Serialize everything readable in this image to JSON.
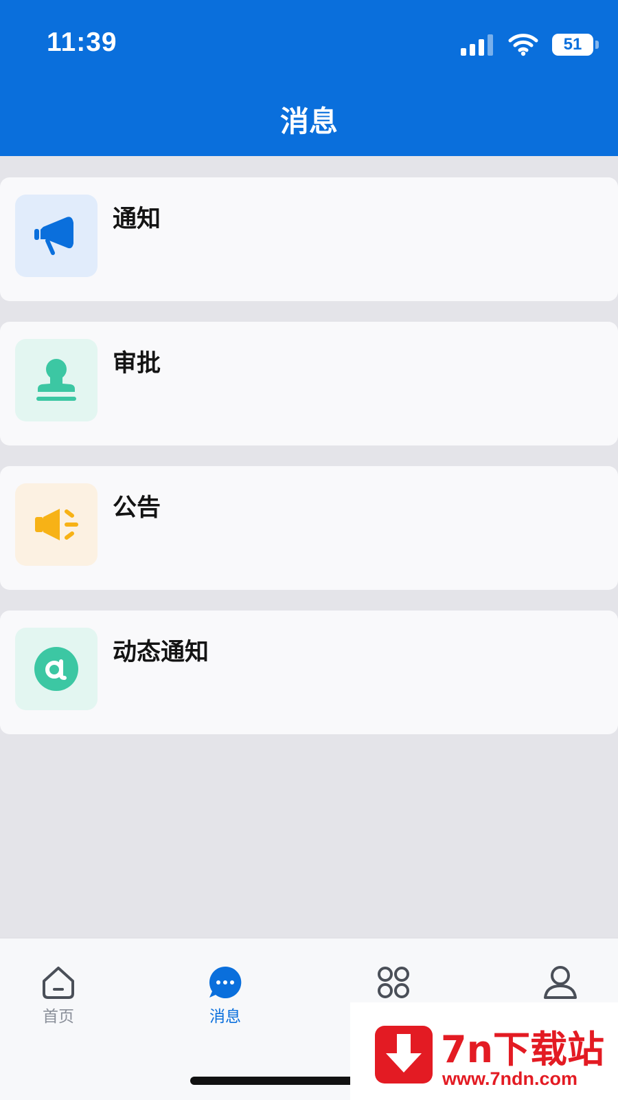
{
  "status_bar": {
    "time": "11:39",
    "battery": "51"
  },
  "header": {
    "title": "消息"
  },
  "messages": [
    {
      "label": "通知",
      "icon": "megaphone-icon",
      "icon_color": "#0a6fdc",
      "tile_color": "#e1ecfb"
    },
    {
      "label": "审批",
      "icon": "approval-stamp-icon",
      "icon_color": "#3cc7a3",
      "tile_color": "#e3f6f1"
    },
    {
      "label": "公告",
      "icon": "speaker-icon",
      "icon_color": "#f7b216",
      "tile_color": "#fcf1e2"
    },
    {
      "label": "动态通知",
      "icon": "at-sign-icon",
      "icon_color": "#3cc7a3",
      "tile_color": "#e3f6f1"
    }
  ],
  "tabbar": {
    "tabs": [
      {
        "label": "首页",
        "icon": "home-icon",
        "active": false
      },
      {
        "label": "消息",
        "icon": "chat-bubble-icon",
        "active": true
      },
      {
        "label": "",
        "icon": "apps-grid-icon",
        "active": false
      },
      {
        "label": "",
        "icon": "user-icon",
        "active": false
      }
    ]
  },
  "colors": {
    "primary": "#0a6fdc",
    "background": "#e4e4e9",
    "card": "#f9f9fb",
    "inactive": "#8a8f99"
  },
  "watermark": {
    "title": "7n下载站",
    "url": "www.7ndn.com"
  }
}
